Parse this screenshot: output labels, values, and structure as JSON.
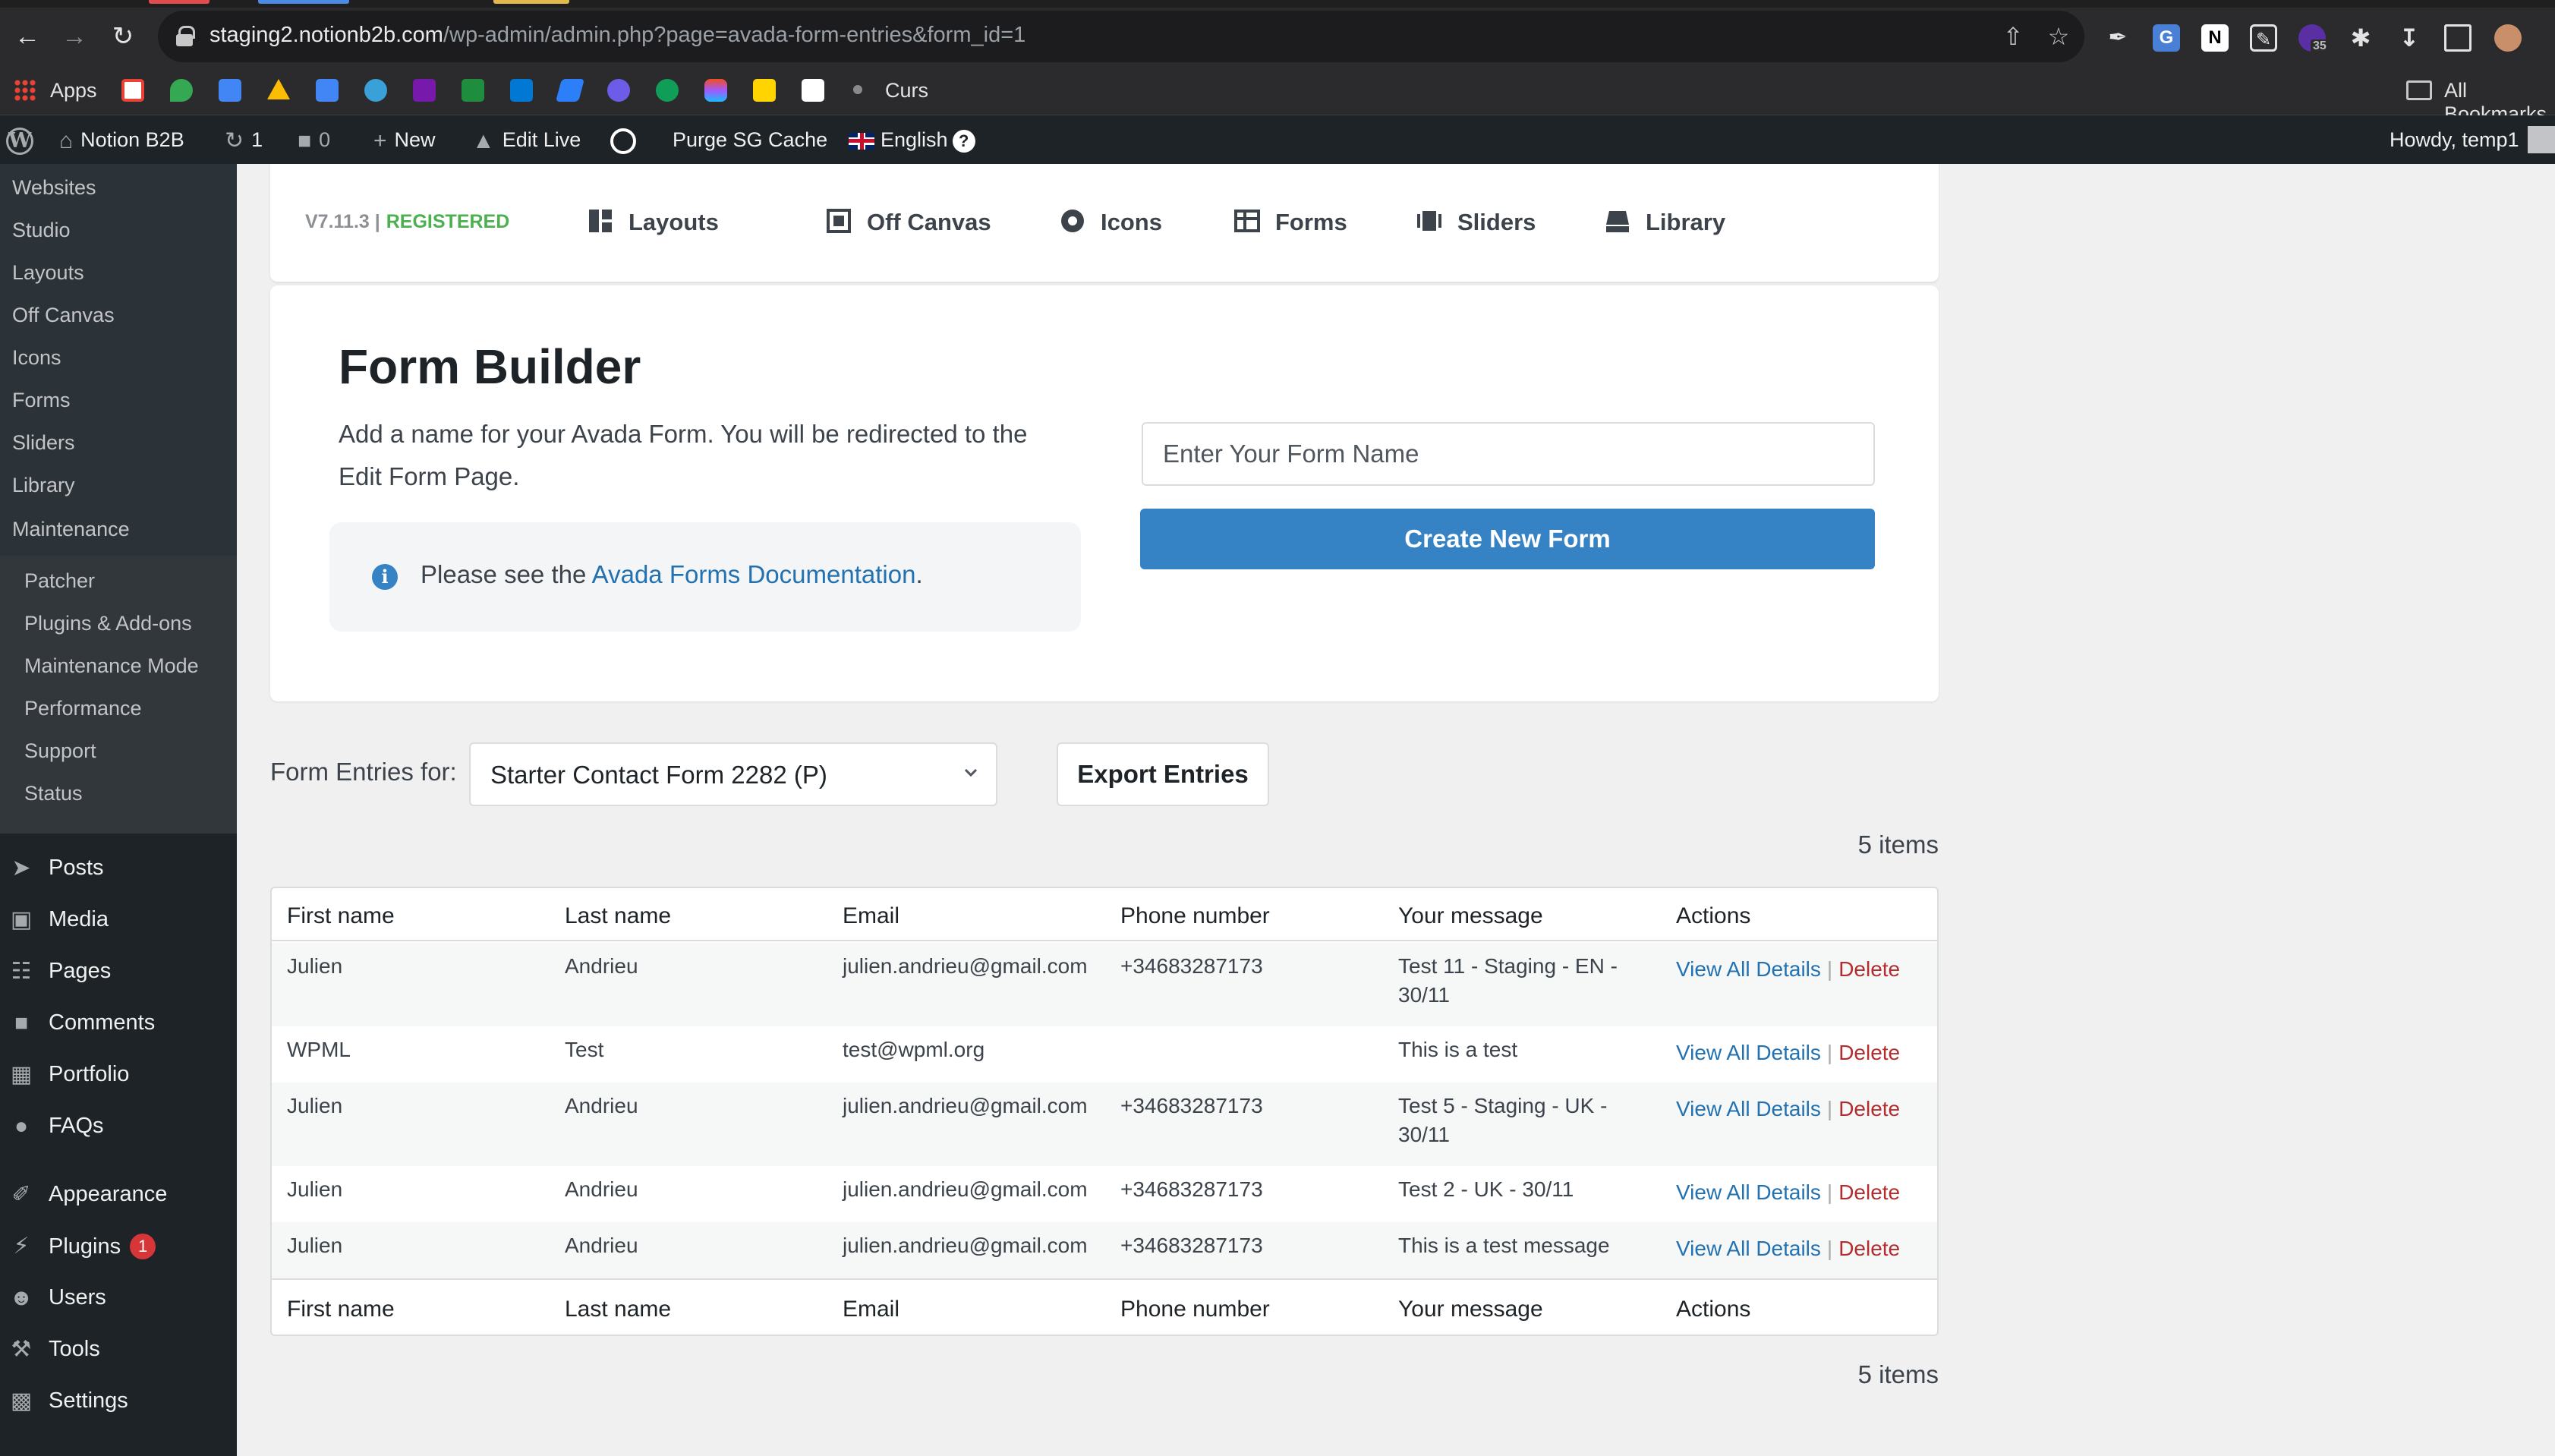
{
  "browser": {
    "url_host": "staging2.notionb2b.com",
    "url_path": "/wp-admin/admin.php?page=avada-form-entries&form_id=1",
    "extension_badge": "35",
    "bookmarks": {
      "apps_label": "Apps",
      "curs_label": "Curs",
      "all_bookmarks_label": "All Bookmarks"
    }
  },
  "adminbar": {
    "site_name": "Notion B2B",
    "updates_count": "1",
    "comments_count": "0",
    "new_label": "New",
    "edit_live_label": "Edit Live",
    "purge_label": "Purge SG Cache",
    "language_label": "English",
    "language_help": "?",
    "howdy": "Howdy, temp1"
  },
  "sidebar": {
    "avada_items": [
      "Websites",
      "Studio",
      "Layouts",
      "Off Canvas",
      "Icons",
      "Forms",
      "Sliders",
      "Library",
      "Maintenance"
    ],
    "maintenance_items": [
      "Patcher",
      "Plugins & Add-ons",
      "Maintenance Mode",
      "Performance",
      "Support",
      "Status"
    ],
    "main_items": [
      {
        "label": "Posts",
        "icon": "pin-icon"
      },
      {
        "label": "Media",
        "icon": "media-icon"
      },
      {
        "label": "Pages",
        "icon": "pages-icon"
      },
      {
        "label": "Comments",
        "icon": "comments-icon"
      },
      {
        "label": "Portfolio",
        "icon": "portfolio-icon"
      },
      {
        "label": "FAQs",
        "icon": "info-icon"
      },
      {
        "label": "Appearance",
        "icon": "brush-icon"
      },
      {
        "label": "Plugins",
        "icon": "plug-icon",
        "badge": "1"
      },
      {
        "label": "Users",
        "icon": "user-icon"
      },
      {
        "label": "Tools",
        "icon": "wrench-icon"
      },
      {
        "label": "Settings",
        "icon": "settings-icon"
      }
    ]
  },
  "topnav": {
    "version": "V7.11.3 |",
    "registered": "REGISTERED",
    "tabs": [
      "Layouts",
      "Off Canvas",
      "Icons",
      "Forms",
      "Sliders",
      "Library"
    ]
  },
  "builder": {
    "title": "Form Builder",
    "description": "Add a name for your Avada Form. You will be redirected to the Edit Form Page.",
    "info_prefix": "Please see the ",
    "info_link": "Avada Forms Documentation",
    "info_suffix": ".",
    "name_placeholder": "Enter Your Form Name",
    "create_label": "Create New Form"
  },
  "entries": {
    "label": "Form Entries for:",
    "selected_form": "Starter Contact Form 2282 (P)",
    "export_label": "Export Entries",
    "count_label": "5 items",
    "columns": [
      "First name",
      "Last name",
      "Email",
      "Phone number",
      "Your message",
      "Actions"
    ],
    "rows": [
      {
        "first": "Julien",
        "last": "Andrieu",
        "email": "julien.andrieu@gmail.com",
        "phone": "+34683287173",
        "message": "Test 11 - Staging - EN - 30/11"
      },
      {
        "first": "WPML",
        "last": "Test",
        "email": "test@wpml.org",
        "phone": "",
        "message": "This is a test"
      },
      {
        "first": "Julien",
        "last": "Andrieu",
        "email": "julien.andrieu@gmail.com",
        "phone": "+34683287173",
        "message": "Test 5 - Staging - UK - 30/11"
      },
      {
        "first": "Julien",
        "last": "Andrieu",
        "email": "julien.andrieu@gmail.com",
        "phone": "+34683287173",
        "message": "Test 2 - UK - 30/11"
      },
      {
        "first": "Julien",
        "last": "Andrieu",
        "email": "julien.andrieu@gmail.com",
        "phone": "+34683287173",
        "message": "This is a test message"
      }
    ],
    "view_label": "View All Details",
    "action_separator": "|",
    "delete_label": "Delete"
  },
  "colors": {
    "admin_dark": "#1d2327",
    "accent_blue": "#3582c4",
    "link_blue": "#2271b1",
    "delete_red": "#b32d2e",
    "registered_green": "#4caf50"
  }
}
